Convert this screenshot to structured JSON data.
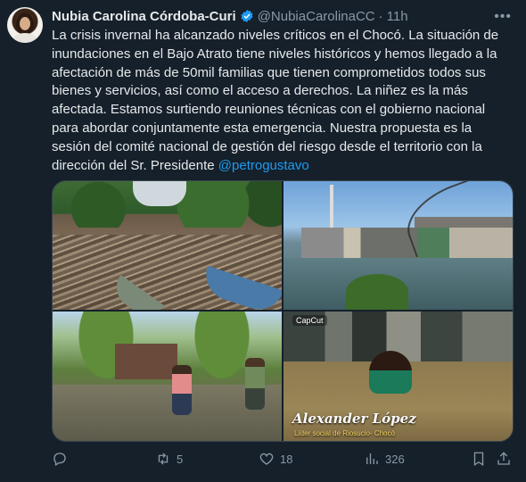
{
  "author": {
    "name": "Nubia Carolina Córdoba-Curi",
    "handle": "@NubiaCarolinaCC",
    "separator": "·",
    "time": "11h",
    "verified": true
  },
  "tweet": {
    "lines": [
      "La crisis invernal ha alcanzado niveles críticos en el Chocó. La situación de",
      "inundaciones en el Bajo Atrato tiene niveles históricos y hemos llegado a la",
      "afectación de más de 50mil familias que tienen comprometidos todos sus",
      "bienes y servicios, así como el acceso a derechos. La niñez es la más",
      "afectada. Estamos surtiendo reuniones técnicas con el gobierno nacional",
      "para abordar conjuntamente esta emergencia.  Nuestra propuesta es la",
      "sesión del comité nacional de gestión del riesgo desde el territorio con la"
    ],
    "last_line_prefix": "dirección del Sr. Presidente ",
    "mention": "@petrogustavo"
  },
  "media": {
    "photo4_logo": "CapCut",
    "photo4_overlay_name": "Alexander López",
    "photo4_overlay_role": "Líder social de Riosucio- Chocó"
  },
  "actions": {
    "replies": "",
    "retweets": "5",
    "likes": "18",
    "views": "326"
  },
  "icons": [
    "more-icon",
    "verified-icon",
    "reply-icon",
    "retweet-icon",
    "like-icon",
    "views-icon",
    "bookmark-icon",
    "share-icon"
  ],
  "colors": {
    "background": "#15202b",
    "text": "#e7e9ea",
    "muted": "#8b98a5",
    "accent": "#1d9bf0"
  }
}
